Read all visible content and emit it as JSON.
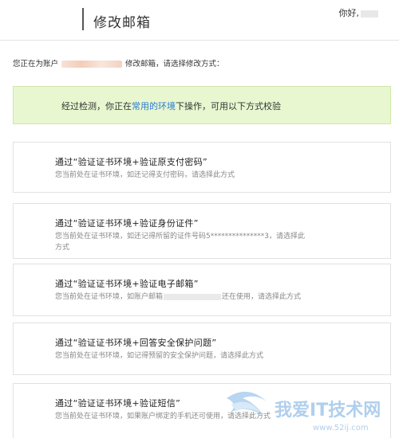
{
  "header": {
    "title": "修改邮箱",
    "greeting": "你好,"
  },
  "intro": {
    "prefix": "您正在为账户",
    "suffix": "修改邮箱，请选择修改方式："
  },
  "notice": {
    "before": "经过检测，你正在",
    "link": "常用的环境",
    "after": "下操作，可用以下方式校验"
  },
  "options": [
    {
      "title": "通过“验证证书环境+验证原支付密码”",
      "desc": "您当前处在证书环境，如还记得支付密码，请选择此方式"
    },
    {
      "title": "通过“验证证书环境+验证身份证件”",
      "desc": "您当前处在证书环境，如还记得所留的证件号码5***************3，请选择此方式"
    },
    {
      "title": "通过“验证证书环境+验证电子邮箱”",
      "desc_before": "您当前处在证书环境，如账户邮箱",
      "desc_after": "还在使用，请选择此方式"
    },
    {
      "title": "通过“验证证书环境+回答安全保护问题”",
      "desc": "您当前处在证书环境，如记得预留的安全保护问题，请选择此方式"
    },
    {
      "title": "通过“验证证书环境+验证短信”",
      "desc": "您当前处在证书环境，如果账户绑定的手机还可使用，请选择此方式"
    }
  ],
  "watermark": {
    "text": "我爱IT技术网",
    "url": "www.52ij.com"
  },
  "colors": {
    "notice_bg": "#e8f7d0",
    "link": "#2a7ad5",
    "desc": "#888888"
  }
}
